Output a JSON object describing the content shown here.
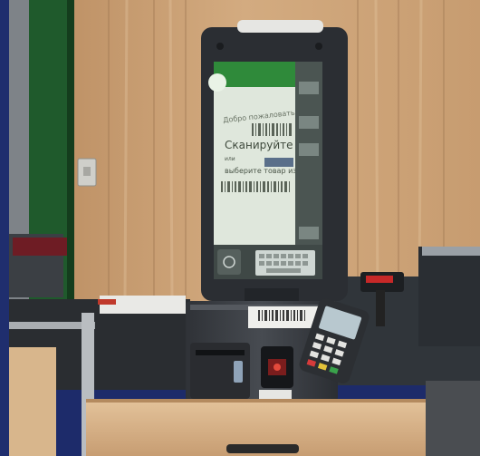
{
  "kiosk_screen": {
    "greeting": "Добро пожаловать",
    "headline": "Сканируйте штрих",
    "or_text": "или",
    "select_text": "выберите товар из ката"
  },
  "colors": {
    "wall_wood": "#c9a27a",
    "kiosk_body": "#3a3d42",
    "screen_bg": "#dfe7dc",
    "brand_green": "#2f8a3a",
    "counter_wood": "#d8b48a",
    "left_frame": "#1f2e6e"
  },
  "icons": [
    "barcode-icon",
    "keyboard-icon",
    "card-terminal-icon",
    "receipt-printer-icon",
    "scanner-icon"
  ]
}
